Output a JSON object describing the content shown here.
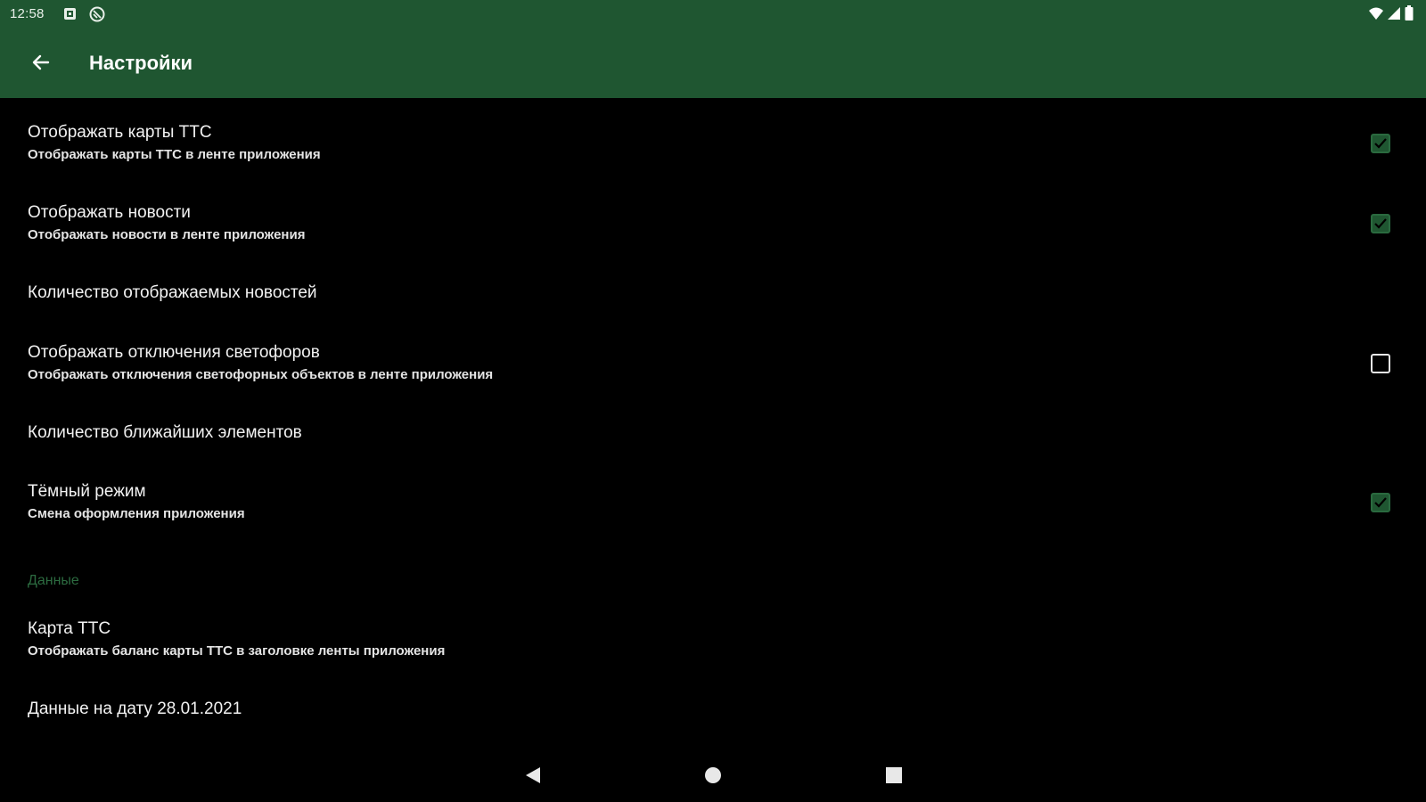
{
  "status_bar": {
    "time": "12:58",
    "icons_left": [
      "notification-square-icon",
      "at-sign-icon"
    ],
    "icons_right": [
      "wifi-icon",
      "signal-icon",
      "battery-icon"
    ]
  },
  "toolbar": {
    "back_icon": "arrow-left-icon",
    "title": "Настройки",
    "background_color": "#1f5631"
  },
  "preferences": [
    {
      "title": "Отображать карты ТТС",
      "summary": "Отображать карты ТТС в ленте приложения",
      "checkbox": true,
      "checked": true
    },
    {
      "title": "Отображать новости",
      "summary": "Отображать новости в ленте приложения",
      "checkbox": true,
      "checked": true
    },
    {
      "title": "Количество отображаемых новостей",
      "summary": "",
      "checkbox": false
    },
    {
      "title": "Отображать отключения светофоров",
      "summary": "Отображать отключения светофорных объектов в ленте приложения",
      "checkbox": true,
      "checked": false
    },
    {
      "title": "Количество ближайших элементов",
      "summary": "",
      "checkbox": false
    },
    {
      "title": "Тёмный режим",
      "summary": "Смена оформления приложения",
      "checkbox": true,
      "checked": true
    }
  ],
  "data_category": {
    "label": "Данные",
    "color": "#2c6b40"
  },
  "data_preferences": [
    {
      "title": "Карта ТТС",
      "summary": "Отображать баланс карты ТТС в заголовке ленты приложения"
    },
    {
      "title": "Данные на дату 28.01.2021",
      "summary": ""
    }
  ],
  "nav_bar": {
    "icons": [
      "back-triangle-icon",
      "home-circle-icon",
      "recents-square-icon"
    ]
  }
}
